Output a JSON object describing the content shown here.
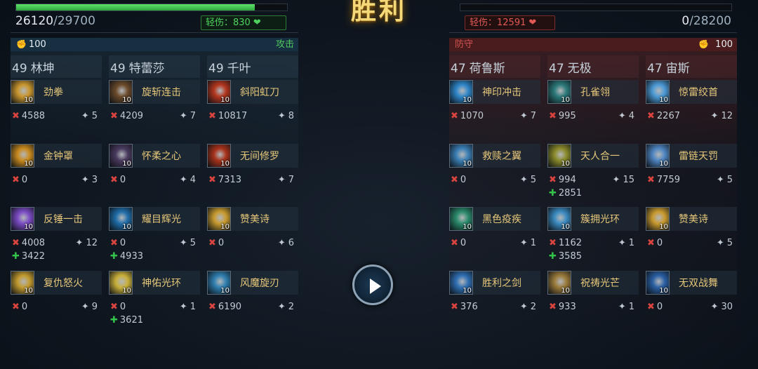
{
  "title": "胜利",
  "left": {
    "hp_current": "26120",
    "hp_max": "/29700",
    "hp_fraction": 0.88,
    "light_injury": "轻伤：830",
    "power": "100",
    "role": "攻击",
    "heroes": [
      {
        "level": "49",
        "name": "林坤",
        "skills": [
          {
            "name": "劲拳",
            "level": "10",
            "damage": "4588",
            "hits": "5",
            "heal": ""
          },
          {
            "name": "金钟罩",
            "level": "10",
            "damage": "0",
            "hits": "3",
            "heal": ""
          },
          {
            "name": "反锤一击",
            "level": "10",
            "damage": "4008",
            "hits": "12",
            "heal": "3422"
          },
          {
            "name": "复仇怒火",
            "level": "10",
            "damage": "0",
            "hits": "9",
            "heal": ""
          }
        ]
      },
      {
        "level": "49",
        "name": "特蕾莎",
        "skills": [
          {
            "name": "旋斩连击",
            "level": "10",
            "damage": "4209",
            "hits": "7",
            "heal": ""
          },
          {
            "name": "怀柔之心",
            "level": "10",
            "damage": "0",
            "hits": "4",
            "heal": ""
          },
          {
            "name": "耀目辉光",
            "level": "10",
            "damage": "0",
            "hits": "5",
            "heal": "4933"
          },
          {
            "name": "神佑光环",
            "level": "10",
            "damage": "0",
            "hits": "1",
            "heal": "3621"
          }
        ]
      },
      {
        "level": "49",
        "name": "千叶",
        "skills": [
          {
            "name": "斜阳虹刀",
            "level": "10",
            "damage": "10817",
            "hits": "8",
            "heal": ""
          },
          {
            "name": "无间修罗",
            "level": "10",
            "damage": "7313",
            "hits": "7",
            "heal": ""
          },
          {
            "name": "赞美诗",
            "level": "10",
            "damage": "0",
            "hits": "6",
            "heal": ""
          },
          {
            "name": "风魔旋刃",
            "level": "10",
            "damage": "6190",
            "hits": "2",
            "heal": ""
          }
        ]
      }
    ]
  },
  "right": {
    "hp_current": "0",
    "hp_max": "/28200",
    "hp_fraction": 0.0,
    "light_injury": "轻伤：12591",
    "power": "100",
    "role": "防守",
    "heroes": [
      {
        "level": "47",
        "name": "荷鲁斯",
        "skills": [
          {
            "name": "神印冲击",
            "level": "10",
            "damage": "1070",
            "hits": "7",
            "heal": ""
          },
          {
            "name": "救赎之翼",
            "level": "10",
            "damage": "0",
            "hits": "5",
            "heal": ""
          },
          {
            "name": "黑色疫疾",
            "level": "10",
            "damage": "0",
            "hits": "1",
            "heal": ""
          },
          {
            "name": "胜利之剑",
            "level": "10",
            "damage": "376",
            "hits": "2",
            "heal": ""
          }
        ]
      },
      {
        "level": "47",
        "name": "无极",
        "skills": [
          {
            "name": "孔雀翎",
            "level": "10",
            "damage": "995",
            "hits": "4",
            "heal": ""
          },
          {
            "name": "天人合一",
            "level": "10",
            "damage": "994",
            "hits": "15",
            "heal": "2851"
          },
          {
            "name": "簇拥光环",
            "level": "10",
            "damage": "1162",
            "hits": "1",
            "heal": "3585"
          },
          {
            "name": "祝祷光芒",
            "level": "10",
            "damage": "933",
            "hits": "1",
            "heal": ""
          }
        ]
      },
      {
        "level": "47",
        "name": "宙斯",
        "skills": [
          {
            "name": "惊雷绞首",
            "level": "10",
            "damage": "2267",
            "hits": "12",
            "heal": ""
          },
          {
            "name": "雷链天罚",
            "level": "10",
            "damage": "7759",
            "hits": "5",
            "heal": ""
          },
          {
            "name": "赞美诗",
            "level": "10",
            "damage": "0",
            "hits": "5",
            "heal": ""
          },
          {
            "name": "无双战舞",
            "level": "10",
            "damage": "0",
            "hits": "30",
            "heal": ""
          }
        ]
      }
    ]
  },
  "icons": {
    "left_skill_colors": [
      [
        "#c9962e",
        "#c98a1e",
        "#7b4bc4",
        "#c29a2e"
      ],
      [
        "#6b4a2a",
        "#4a3a5e",
        "#1f6da8",
        "#c9b03a"
      ],
      [
        "#b3361e",
        "#a8321b",
        "#c79a2e",
        "#2f7fb0"
      ]
    ],
    "right_skill_colors": [
      [
        "#2f86c9",
        "#3b7fb5",
        "#2a8a6a",
        "#2f6fb3"
      ],
      [
        "#2c7a7a",
        "#8a8a2a",
        "#3a8ac0",
        "#9a7a3a"
      ],
      [
        "#4c9ad6",
        "#4f86c2",
        "#c99a2e",
        "#2a5fa3"
      ]
    ]
  },
  "colors": {
    "victory_gold": "#f5d978",
    "ally_green": "#4fd35e",
    "enemy_red": "#e25a55",
    "damage_x": "#d9443f",
    "heal_plus": "#33c24a"
  }
}
